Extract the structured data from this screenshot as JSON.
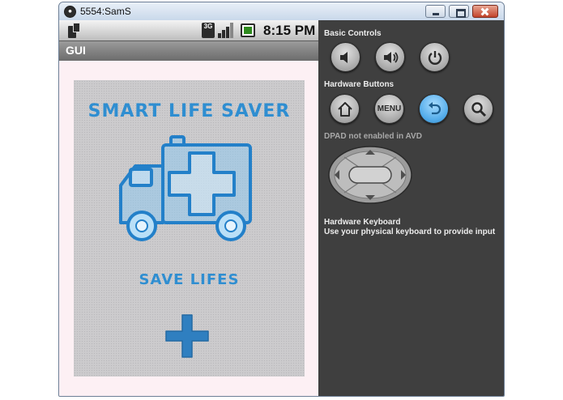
{
  "window": {
    "title": "5554:SamS"
  },
  "device": {
    "status": {
      "network": "3G",
      "time": "8:15 PM"
    },
    "app_title": "GUI",
    "content": {
      "title": "SMART LIFE SAVER",
      "subtitle": "SAVE LIFES"
    }
  },
  "panel": {
    "basic_controls": "Basic Controls",
    "hardware_buttons": "Hardware Buttons",
    "menu_label": "MENU",
    "dpad_note": "DPAD not enabled in AVD",
    "keyboard_title": "Hardware Keyboard",
    "keyboard_note": "Use your physical keyboard to provide input"
  },
  "colors": {
    "accent": "#2f8ed1",
    "panel_bg": "#3f3f3f",
    "active_button": "#54acea"
  }
}
